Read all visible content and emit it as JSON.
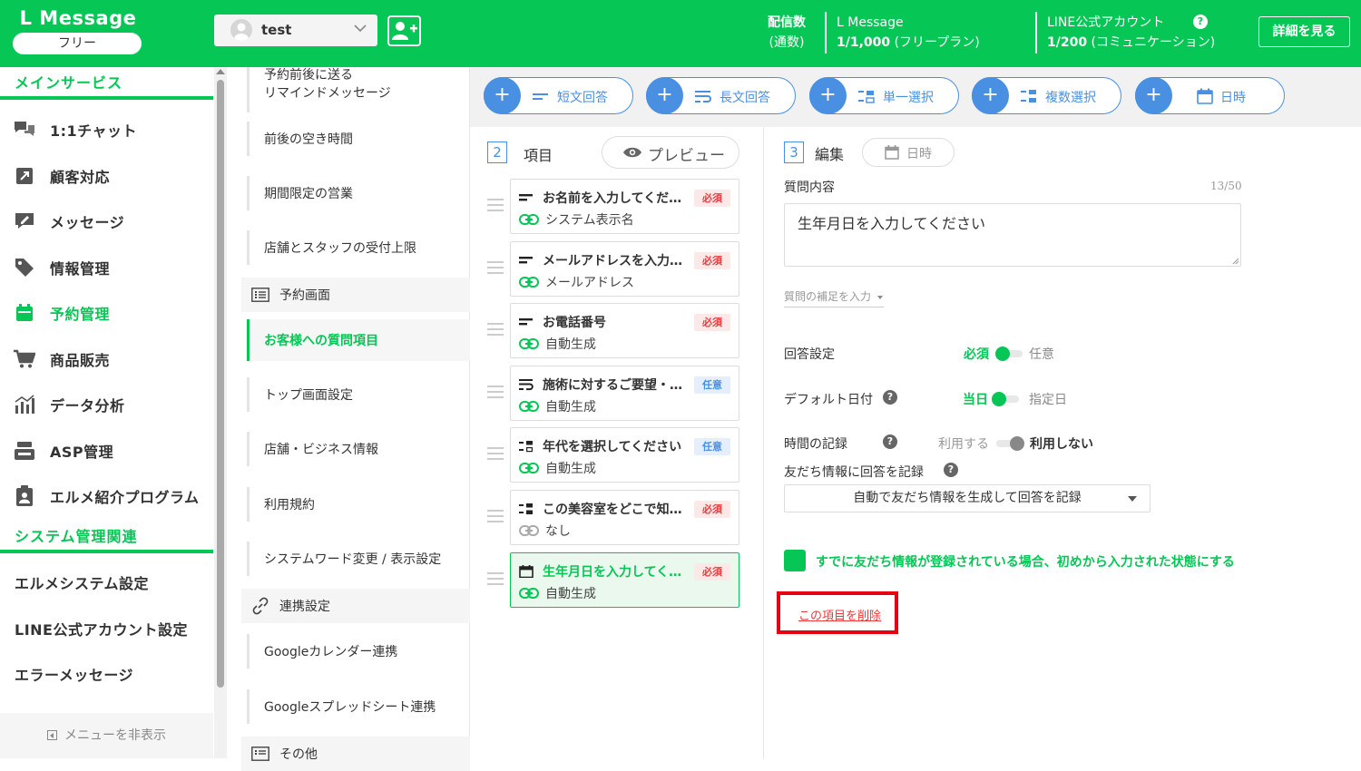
{
  "header": {
    "brand": "L Message",
    "plan": "フリー",
    "account_name": "test",
    "sends_label_1": "配信数",
    "sends_label_2": "(通数)",
    "lmessage_label": "L Message",
    "lmessage_value": "1/1,000",
    "lmessage_plan": "(フリープラン)",
    "line_label": "LINE公式アカウント",
    "line_value": "1/200",
    "line_plan": "(コミュニケーション)",
    "detail_button": "詳細を見る",
    "accent_color": "#06c755"
  },
  "sidebar": {
    "main_section": "メインサービス",
    "items": [
      {
        "label": "1:1チャット",
        "icon": "chat-icon"
      },
      {
        "label": "顧客対応",
        "icon": "external-link-icon"
      },
      {
        "label": "メッセージ",
        "icon": "message-edit-icon"
      },
      {
        "label": "情報管理",
        "icon": "tag-icon"
      },
      {
        "label": "予約管理",
        "icon": "calendar-icon",
        "active": true
      },
      {
        "label": "商品販売",
        "icon": "cart-icon"
      },
      {
        "label": "データ分析",
        "icon": "bar-chart-icon"
      },
      {
        "label": "ASP管理",
        "icon": "register-icon"
      },
      {
        "label": "エルメ紹介プログラム",
        "icon": "clipboard-user-icon"
      }
    ],
    "system_section": "システム管理関連",
    "system_items": [
      "エルメシステム設定",
      "LINE公式アカウント設定",
      "エラーメッセージ"
    ],
    "hide_menu": "メニューを非表示"
  },
  "submenu": {
    "items_top": [
      {
        "label_1": "予約前後に送る",
        "label_2": "リマインドメッセージ"
      },
      {
        "label": "前後の空き時間"
      },
      {
        "label": "期間限定の営業"
      },
      {
        "label": "店舗とスタッフの受付上限"
      }
    ],
    "head_reservation": "予約画面",
    "active_item": "お客様への質問項目",
    "items_mid": [
      "トップ画面設定",
      "店舗・ビジネス情報",
      "利用規約",
      "システムワード変更 / 表示設定"
    ],
    "head_integration": "連携設定",
    "items_int": [
      "Googleカレンダー連携",
      "Googleスプレッドシート連携"
    ],
    "head_other": "その他"
  },
  "toolbar": {
    "buttons": [
      {
        "label": "短文回答",
        "icon": "short-text-icon"
      },
      {
        "label": "長文回答",
        "icon": "long-text-icon"
      },
      {
        "label": "単一選択",
        "icon": "single-choice-icon"
      },
      {
        "label": "複数選択",
        "icon": "multi-choice-icon"
      },
      {
        "label": "日時",
        "icon": "calendar-icon"
      }
    ]
  },
  "items_panel": {
    "step": "2",
    "title": "項目",
    "preview": "プレビュー",
    "items": [
      {
        "title": "お名前を入力してくだ…",
        "badge": "必須",
        "required": true,
        "sub": "システム表示名",
        "icon": "short-text-icon",
        "linked": true
      },
      {
        "title": "メールアドレスを入力…",
        "badge": "必須",
        "required": true,
        "sub": "メールアドレス",
        "icon": "short-text-icon",
        "linked": true
      },
      {
        "title": "お電話番号",
        "badge": "必須",
        "required": true,
        "sub": "自動生成",
        "icon": "short-text-icon",
        "linked": true
      },
      {
        "title": "施術に対するご要望・…",
        "badge": "任意",
        "required": false,
        "sub": "自動生成",
        "icon": "long-text-icon",
        "linked": true
      },
      {
        "title": "年代を選択してください",
        "badge": "任意",
        "required": false,
        "sub": "自動生成",
        "icon": "single-choice-icon",
        "linked": true
      },
      {
        "title": "この美容室をどこで知…",
        "badge": "必須",
        "required": true,
        "sub": "なし",
        "icon": "multi-choice-icon",
        "linked": false
      },
      {
        "title": "生年月日を入力してく…",
        "badge": "必須",
        "required": true,
        "sub": "自動生成",
        "icon": "calendar-icon",
        "linked": true,
        "selected": true
      }
    ]
  },
  "edit_panel": {
    "step": "3",
    "title": "編集",
    "type": "日時",
    "question_label": "質問内容",
    "counter": "13/50",
    "question_value": "生年月日を入力してください",
    "supplement_link": "質問の補足を入力",
    "answer_setting": "回答設定",
    "answer_on": "必須",
    "answer_off": "任意",
    "default_date": "デフォルト日付",
    "default_on": "当日",
    "default_off": "指定日",
    "time_record": "時間の記録",
    "time_use": "利用する",
    "time_nouse": "利用しない",
    "friend_record": "友だち情報に回答を記録",
    "friend_select": "自動で友だち情報を生成して回答を記録",
    "prefill_label": "すでに友だち情報が登録されている場合、初めから入力された状態にする",
    "delete_link": "この項目を削除"
  }
}
